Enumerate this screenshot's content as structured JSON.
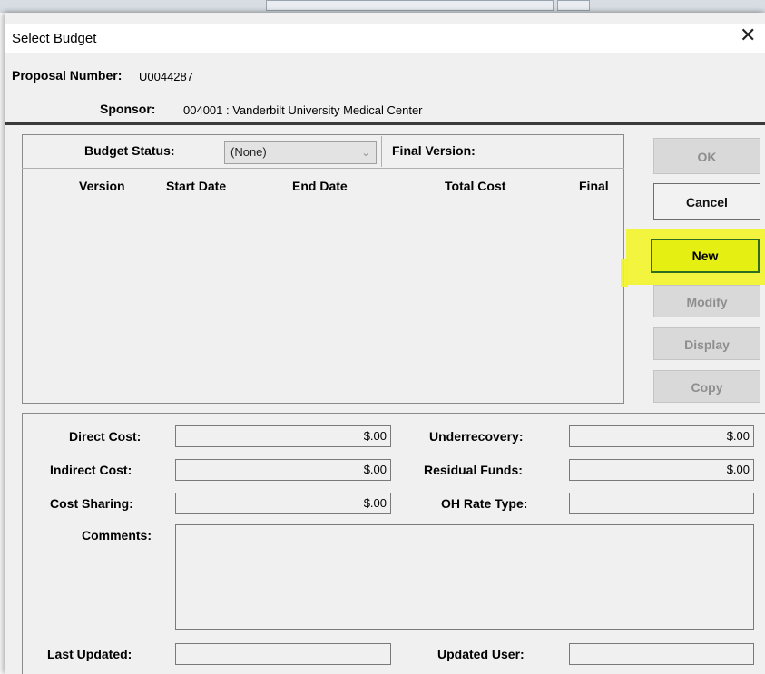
{
  "window": {
    "title": "Select Budget",
    "close_symbol": "✕"
  },
  "header": {
    "proposal_label": "Proposal Number:",
    "proposal_value": "U0044287",
    "sponsor_label": "Sponsor:",
    "sponsor_value": "004001 : Vanderbilt University Medical Center"
  },
  "budget": {
    "status_label": "Budget Status:",
    "status_value": "(None)",
    "final_version_label": "Final Version:",
    "final_version_value": "",
    "columns": [
      "Version",
      "Start Date",
      "End Date",
      "Total Cost",
      "Final"
    ]
  },
  "buttons": {
    "ok": "OK",
    "cancel": "Cancel",
    "new": "New",
    "modify": "Modify",
    "display": "Display",
    "copy": "Copy"
  },
  "costs": {
    "direct_cost_label": "Direct Cost:",
    "direct_cost_value": "$.00",
    "indirect_cost_label": "Indirect Cost:",
    "indirect_cost_value": "$.00",
    "cost_sharing_label": "Cost Sharing:",
    "cost_sharing_value": "$.00",
    "underrecovery_label": "Underrecovery:",
    "underrecovery_value": "$.00",
    "residual_funds_label": "Residual Funds:",
    "residual_funds_value": "$.00",
    "oh_rate_type_label": "OH Rate Type:",
    "oh_rate_type_value": "",
    "comments_label": "Comments:",
    "comments_value": "",
    "last_updated_label": "Last Updated:",
    "last_updated_value": "",
    "updated_user_label": "Updated User:",
    "updated_user_value": ""
  },
  "colors": {
    "highlight": "#f2f42a",
    "new_button_border": "#2f6d20"
  }
}
